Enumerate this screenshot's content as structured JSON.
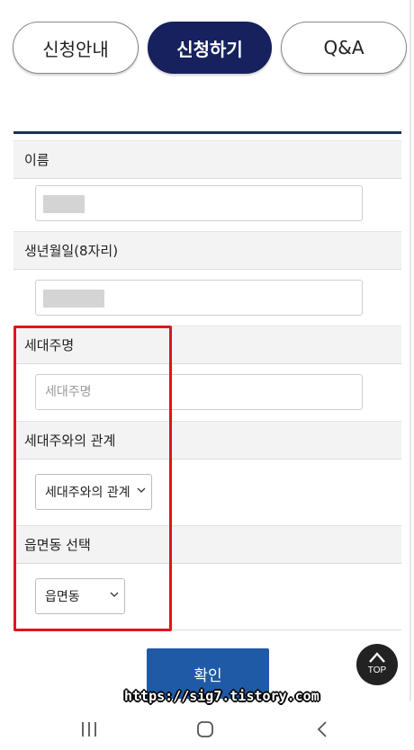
{
  "tabs": [
    {
      "label": "신청안내",
      "active": false
    },
    {
      "label": "신청하기",
      "active": true
    },
    {
      "label": "Q&A",
      "active": false
    }
  ],
  "form": {
    "name_label": "이름",
    "birth_label": "생년월일(8자리)",
    "householder_label": "세대주명",
    "householder_placeholder": "세대주명",
    "relation_label": "세대주와의 관계",
    "relation_selected": "세대주와의 관계",
    "district_label": "읍면동 선택",
    "district_selected": "읍면동"
  },
  "confirm_label": "확인",
  "top_button_label": "TOP",
  "watermark": "https://sig7.tistory.com",
  "colors": {
    "active_tab": "#17215e",
    "confirm_button": "#1f5aa6",
    "highlight_box": "#e2141a",
    "form_top_border": "#1f3157"
  },
  "icons": {
    "select_arrow": "chevron-down-icon",
    "top": "chevron-up-icon",
    "nav_recent": "recent-apps-icon",
    "nav_home": "home-icon",
    "nav_back": "back-icon"
  }
}
